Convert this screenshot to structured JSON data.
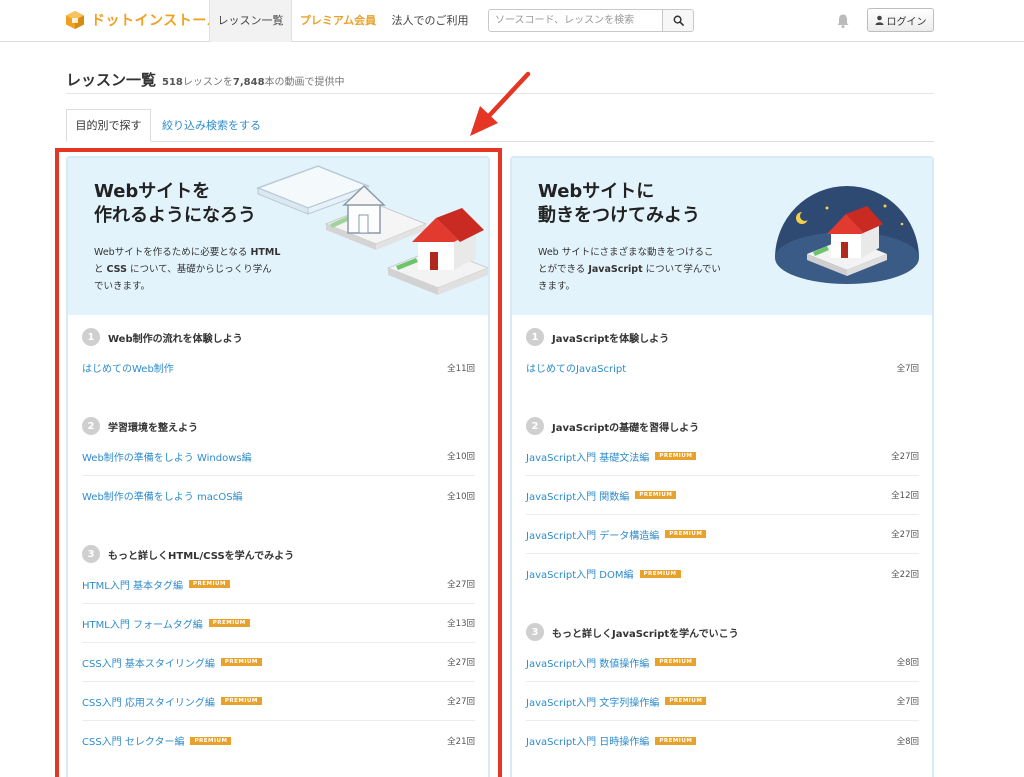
{
  "header": {
    "logo_text": "ドットインストール",
    "nav": [
      {
        "label": "レッスン一覧"
      },
      {
        "label": "プレミアム会員"
      },
      {
        "label": "法人でのご利用"
      }
    ],
    "search_placeholder": "ソースコード、レッスンを検索",
    "login_label": "ログイン"
  },
  "page": {
    "title": "レッスン一覧",
    "count_lessons": "518",
    "count_mid": "レッスンを",
    "count_videos": "7,848",
    "count_end": "本の動画で提供中"
  },
  "tabs": [
    {
      "label": "目的別で探す"
    },
    {
      "label": "絞り込み検索をする"
    }
  ],
  "colors": {
    "accent": "#e8a22c",
    "link": "#2e8bcc",
    "highlight": "#e53524",
    "hero_bg": "#e3f3fc"
  },
  "cards": [
    {
      "title_l1": "Webサイトを",
      "title_l2": "作れるようになろう",
      "desc_a": "Webサイトを作るために必要となる ",
      "desc_b": "HTML",
      "desc_c": "と ",
      "desc_d": "CSS",
      "desc_e": " について、基礎からじっくり学ん",
      "desc_f": "でいきます。",
      "sections": [
        {
          "num": "1",
          "title": "Web制作の流れを体験しよう",
          "lessons": [
            {
              "name": "はじめてのWeb制作",
              "count": "全11回"
            }
          ]
        },
        {
          "num": "2",
          "title": "学習環境を整えよう",
          "lessons": [
            {
              "name": "Web制作の準備をしよう Windows編",
              "count": "全10回"
            },
            {
              "name": "Web制作の準備をしよう macOS編",
              "count": "全10回"
            }
          ]
        },
        {
          "num": "3",
          "title": "もっと詳しくHTML/CSSを学んでみよう",
          "lessons": [
            {
              "name": "HTML入門 基本タグ編",
              "badge": "PREMIUM",
              "count": "全27回"
            },
            {
              "name": "HTML入門 フォームタグ編",
              "badge": "PREMIUM",
              "count": "全13回"
            },
            {
              "name": "CSS入門 基本スタイリング編",
              "badge": "PREMIUM",
              "count": "全27回"
            },
            {
              "name": "CSS入門 応用スタイリング編",
              "badge": "PREMIUM",
              "count": "全27回"
            },
            {
              "name": "CSS入門 セレクター編",
              "badge": "PREMIUM",
              "count": "全21回"
            }
          ]
        }
      ]
    },
    {
      "title_l1": "Webサイトに",
      "title_l2": "動きをつけてみよう",
      "desc_a": "Web サイトにさまざまな動きをつけるこ",
      "desc_b": "",
      "desc_c": "とができる ",
      "desc_d": "JavaScript",
      "desc_e": " について学んでい",
      "desc_f": "きます。",
      "sections": [
        {
          "num": "1",
          "title": "JavaScriptを体験しよう",
          "lessons": [
            {
              "name": "はじめてのJavaScript",
              "count": "全7回"
            }
          ]
        },
        {
          "num": "2",
          "title": "JavaScriptの基礎を習得しよう",
          "lessons": [
            {
              "name": "JavaScript入門 基礎文法編",
              "badge": "PREMIUM",
              "count": "全27回"
            },
            {
              "name": "JavaScript入門 関数編",
              "badge": "PREMIUM",
              "count": "全12回"
            },
            {
              "name": "JavaScript入門 データ構造編",
              "badge": "PREMIUM",
              "count": "全27回"
            },
            {
              "name": "JavaScript入門 DOM編",
              "badge": "PREMIUM",
              "count": "全22回"
            }
          ]
        },
        {
          "num": "3",
          "title": "もっと詳しくJavaScriptを学んでいこう",
          "lessons": [
            {
              "name": "JavaScript入門 数値操作編",
              "badge": "PREMIUM",
              "count": "全8回"
            },
            {
              "name": "JavaScript入門 文字列操作編",
              "badge": "PREMIUM",
              "count": "全7回"
            },
            {
              "name": "JavaScript入門 日時操作編",
              "badge": "PREMIUM",
              "count": "全8回"
            }
          ]
        }
      ]
    }
  ]
}
